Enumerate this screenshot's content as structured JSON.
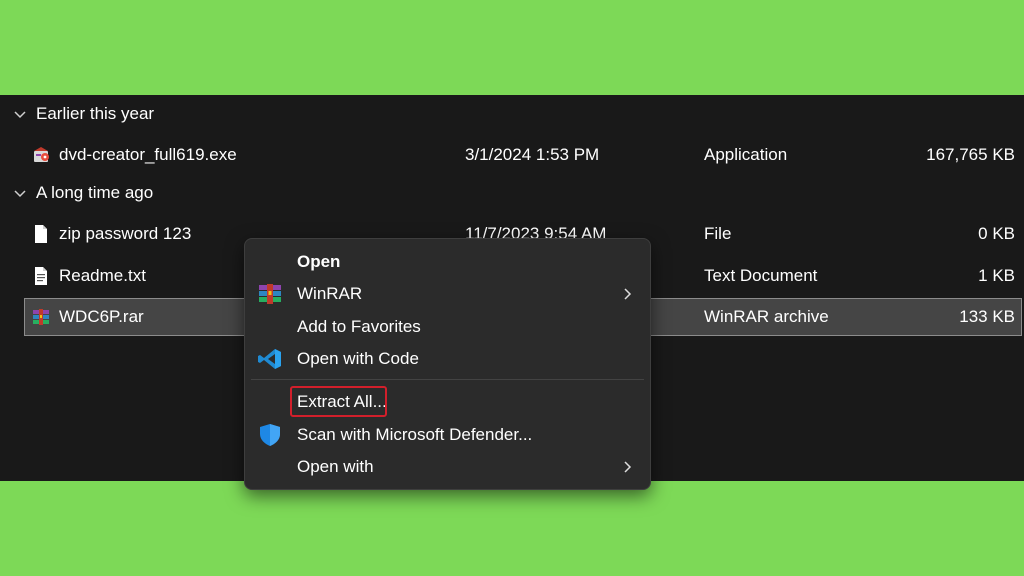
{
  "groups": [
    {
      "label": "Earlier this year"
    },
    {
      "label": "A long time ago"
    }
  ],
  "files": [
    {
      "name": "dvd-creator_full619.exe",
      "date": "3/1/2024 1:53 PM",
      "type": "Application",
      "size": "167,765 KB",
      "icon": "installer-icon"
    },
    {
      "name": "zip password 123",
      "date": "11/7/2023 9:54 AM",
      "type": "File",
      "size": "0 KB",
      "icon": "blank-file-icon"
    },
    {
      "name": "Readme.txt",
      "date": "",
      "type": "Text Document",
      "size": "1 KB",
      "icon": "text-file-icon"
    },
    {
      "name": "WDC6P.rar",
      "date": "",
      "type": "WinRAR archive",
      "size": "133 KB",
      "icon": "winrar-archive-icon",
      "selected": true
    }
  ],
  "context_menu": {
    "items": [
      {
        "label": "Open",
        "bold": true
      },
      {
        "label": "WinRAR",
        "icon": "winrar-icon",
        "submenu": true
      },
      {
        "label": "Add to Favorites"
      },
      {
        "label": "Open with Code",
        "icon": "vscode-icon"
      },
      {
        "label": "Extract All...",
        "highlighted": true
      },
      {
        "label": "Scan with Microsoft Defender...",
        "icon": "defender-shield-icon"
      },
      {
        "label": "Open with",
        "submenu": true
      }
    ]
  },
  "colors": {
    "background": "#7dd957",
    "explorer_bg": "#191919",
    "menu_bg": "#2b2b2b",
    "highlight_border": "#d21f2b"
  }
}
